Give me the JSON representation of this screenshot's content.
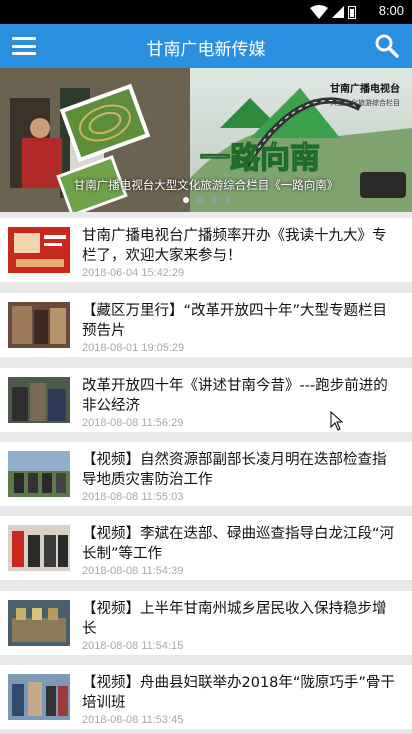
{
  "status": {
    "time": "8:00"
  },
  "header": {
    "title": "甘南广电新传媒",
    "menu_icon": "menu-icon",
    "search_icon": "search-icon"
  },
  "banner": {
    "caption": "甘南广播电视台大型文化旅游综合栏目《一路向南》",
    "logo_title": "甘南广播电视台",
    "logo_subtitle": "大型文化旅游综合栏目",
    "show_title": "一路向南",
    "dots": [
      1,
      0,
      0,
      0
    ]
  },
  "articles": [
    {
      "title": "甘南广播电视台广播频率开办《我读十九大》专栏了，欢迎大家来参与！",
      "date": "2018-06-04 15:42:29"
    },
    {
      "title": "【藏区万里行】“改革开放四十年”大型专题栏目预告片",
      "date": "2018-08-01 19:05:29"
    },
    {
      "title": "改革开放四十年《讲述甘南今昔》---跑步前进的非公经济",
      "date": "2018-08-08 11:56:29"
    },
    {
      "title": "【视频】自然资源部副部长凌月明在迭部检查指导地质灾害防治工作",
      "date": "2018-08-08 11:55:03"
    },
    {
      "title": "【视频】李斌在迭部、碌曲巡查指导白龙江段“河长制”等工作",
      "date": "2018-08-08 11:54:39"
    },
    {
      "title": "【视频】上半年甘南州城乡居民收入保持稳步增长",
      "date": "2018-08-08 11:54:15"
    },
    {
      "title": "【视频】舟曲县妇联举办2018年“陇原巧手”骨干培训班",
      "date": "2018-08-08 11:53:45"
    }
  ]
}
